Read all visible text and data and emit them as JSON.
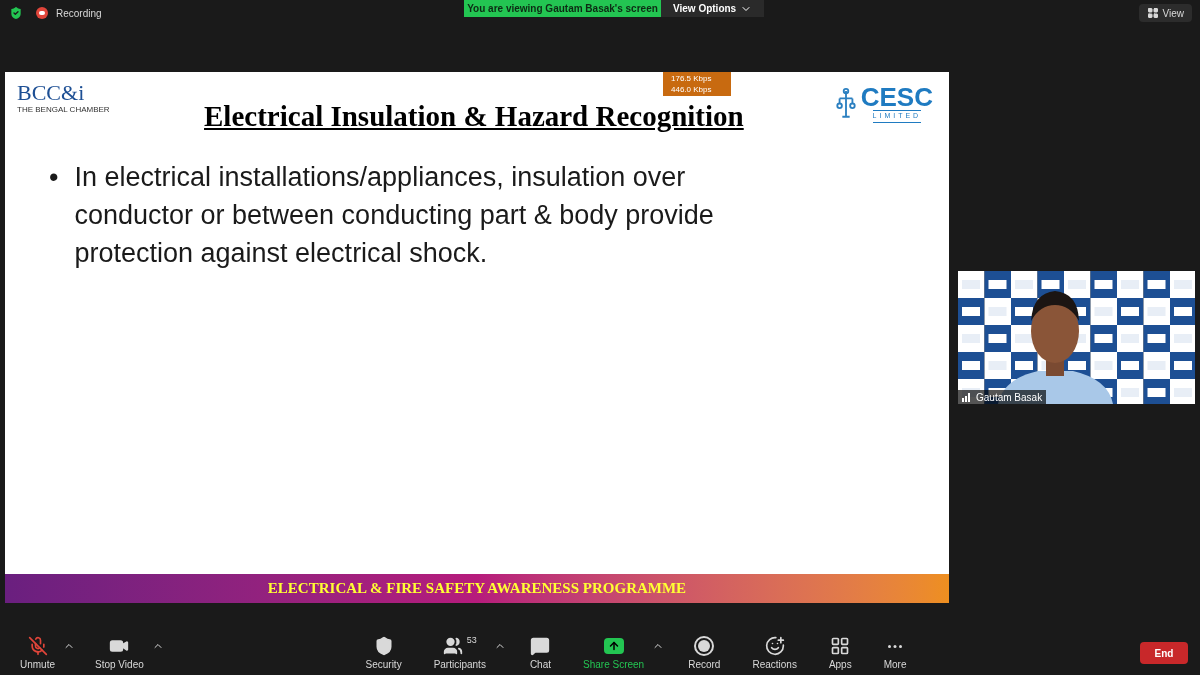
{
  "top_bar": {
    "recording_label": "Recording",
    "banner": "You are viewing Gautam Basak's screen",
    "view_options": "View Options",
    "view_button": "View"
  },
  "slide": {
    "left_logo": {
      "mark": "BCC&i",
      "caption": "THE BENGAL CHAMBER"
    },
    "title": "Electrical Insulation & Hazard Recognition",
    "right_logo": {
      "mark": "CESC",
      "caption": "LIMITED"
    },
    "stats": [
      "176.5 Kbps",
      "446.0 Kbps"
    ],
    "bullets": [
      {
        "marker": "•",
        "text": "In electrical installations/appliances, insulation over conductor or between conducting part & body provide protection against electrical shock."
      }
    ],
    "footer": "ELECTRICAL & FIRE SAFETY AWARENESS PROGRAMME"
  },
  "video_tile": {
    "name": "Gautam Basak"
  },
  "toolbar": {
    "left": [
      {
        "kind": "mic",
        "label": "Unmute",
        "muted": true,
        "caret": true
      },
      {
        "kind": "video",
        "label": "Stop Video",
        "caret": true
      }
    ],
    "center": [
      {
        "kind": "security",
        "label": "Security",
        "caret": false
      },
      {
        "kind": "participants",
        "label": "Participants",
        "count": "53",
        "caret": true
      },
      {
        "kind": "chat",
        "label": "Chat",
        "caret": false
      },
      {
        "kind": "share",
        "label": "Share Screen",
        "active": true,
        "caret": true
      },
      {
        "kind": "record",
        "label": "Record",
        "caret": false
      },
      {
        "kind": "reactions",
        "label": "Reactions",
        "caret": false
      },
      {
        "kind": "apps",
        "label": "Apps",
        "caret": false
      },
      {
        "kind": "more",
        "label": "More",
        "caret": false
      }
    ],
    "end_button": "End"
  }
}
